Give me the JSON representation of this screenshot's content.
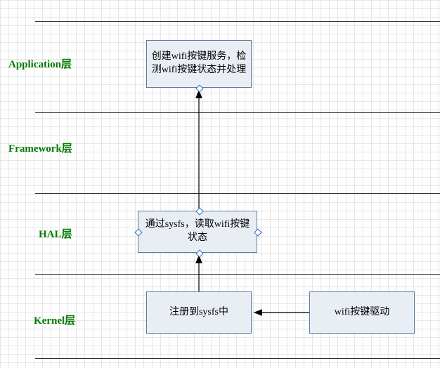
{
  "chart_data": {
    "type": "diagram",
    "title": "",
    "layers": [
      {
        "id": "application",
        "label": "Application层",
        "y_band": [
          30,
          160
        ]
      },
      {
        "id": "framework",
        "label": "Framework层",
        "y_band": [
          160,
          275
        ]
      },
      {
        "id": "hal",
        "label": "HAL层",
        "y_band": [
          275,
          390
        ]
      },
      {
        "id": "kernel",
        "label": "Kernel层",
        "y_band": [
          390,
          510
        ]
      }
    ],
    "nodes": [
      {
        "id": "app_box",
        "layer": "application",
        "text": "创建wifi按键服务，检测wifi按键状态并处理"
      },
      {
        "id": "hal_box",
        "layer": "hal",
        "text": "通过sysfs，读取wifi按键状态"
      },
      {
        "id": "sysfs_box",
        "layer": "kernel",
        "text": "注册到sysfs中"
      },
      {
        "id": "driver_box",
        "layer": "kernel",
        "text": "wifi按键驱动"
      }
    ],
    "edges": [
      {
        "from": "driver_box",
        "to": "sysfs_box",
        "dir": "left"
      },
      {
        "from": "sysfs_box",
        "to": "hal_box",
        "dir": "up"
      },
      {
        "from": "hal_box",
        "to": "app_box",
        "dir": "up"
      }
    ]
  },
  "layers": {
    "application": {
      "label": "Application层"
    },
    "framework": {
      "label": "Framework层"
    },
    "hal": {
      "label": "HAL层"
    },
    "kernel": {
      "label": "Kernel层"
    }
  },
  "boxes": {
    "app": {
      "text": "创建wifi按键服务，检测wifi按键状态并处理"
    },
    "hal": {
      "text": "通过sysfs，读取wifi按键状态"
    },
    "sysfs": {
      "text": "注册到sysfs中"
    },
    "driver": {
      "text": "wifi按键驱动"
    }
  }
}
